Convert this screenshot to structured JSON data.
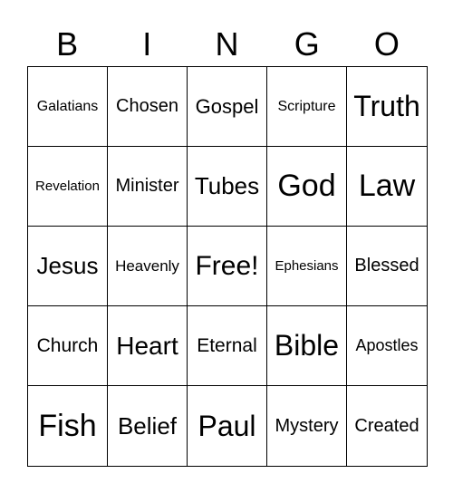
{
  "header": [
    "B",
    "I",
    "N",
    "G",
    "O"
  ],
  "cells": [
    "Galatians",
    "Chosen",
    "Gospel",
    "Scripture",
    "Truth",
    "Revelation",
    "Minister",
    "Tubes",
    "God",
    "Law",
    "Jesus",
    "Heavenly",
    "Free!",
    "Ephesians",
    "Blessed",
    "Church",
    "Heart",
    "Eternal",
    "Bible",
    "Apostles",
    "Fish",
    "Belief",
    "Paul",
    "Mystery",
    "Created"
  ]
}
